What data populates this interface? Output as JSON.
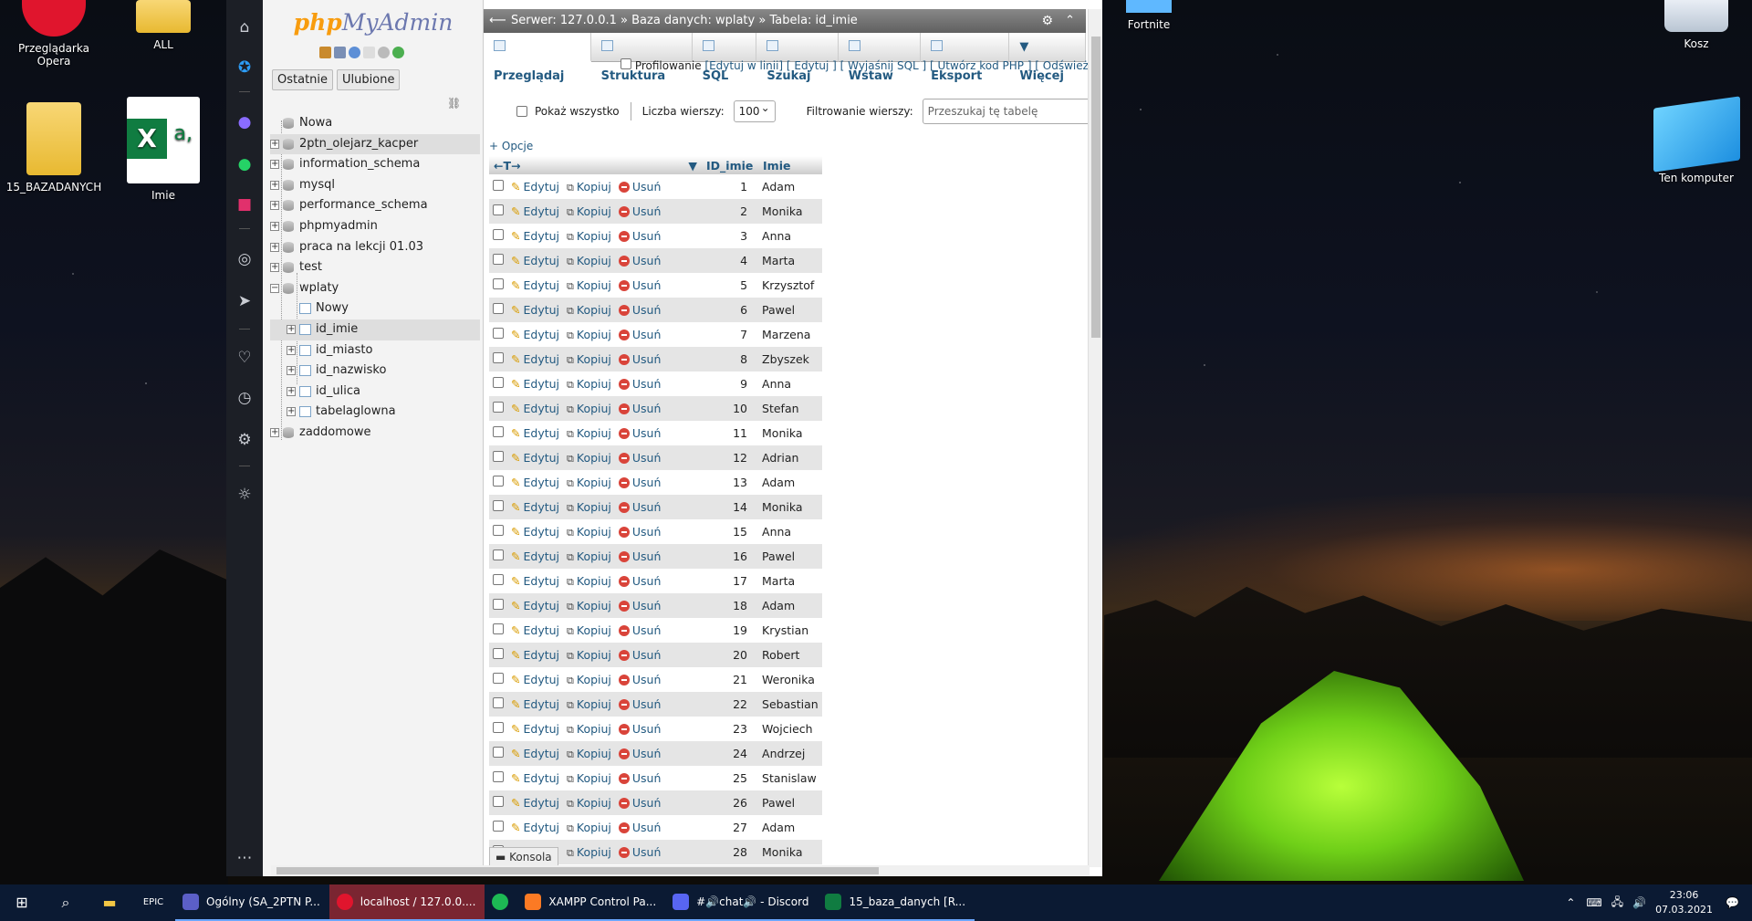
{
  "desktop": {
    "icons": [
      {
        "label": "Przeglądarka Opera"
      },
      {
        "label": "ALL"
      },
      {
        "label": "15_BAZADANYCH"
      },
      {
        "label": "Imie"
      },
      {
        "label": "Fortnite"
      },
      {
        "label": "Kosz"
      },
      {
        "label": "Ten komputer"
      }
    ]
  },
  "sidebar": {
    "logo_php": "php",
    "logo_my": "MyAdmin",
    "tabs": [
      "Ostatnie",
      "Ulubione"
    ],
    "tree": [
      {
        "label": "Nowa"
      },
      {
        "label": "2ptn_olejarz_kacper"
      },
      {
        "label": "information_schema"
      },
      {
        "label": "mysql"
      },
      {
        "label": "performance_schema"
      },
      {
        "label": "phpmyadmin"
      },
      {
        "label": "praca na lekcji 01.03"
      },
      {
        "label": "test"
      },
      {
        "label": "wplaty"
      },
      {
        "label": "Nowy"
      },
      {
        "label": "id_imie"
      },
      {
        "label": "id_miasto"
      },
      {
        "label": "id_nazwisko"
      },
      {
        "label": "id_ulica"
      },
      {
        "label": "tabelaglowna"
      },
      {
        "label": "zaddomowe"
      }
    ]
  },
  "breadcrumb": {
    "server": "Serwer: 127.0.0.1 »",
    "database": "Baza danych: wplaty »",
    "table": "Tabela: id_imie"
  },
  "menu": [
    "Przeglądaj",
    "Struktura",
    "SQL",
    "Szukaj",
    "Wstaw",
    "Eksport",
    "Więcej"
  ],
  "clipped_row": {
    "label": "Profilowanie",
    "links": "[Edytuj w linii] [ Edytuj ] [ Wyjaśnij SQL ] [ Utwórz kod PHP ] [ Odśwież ]"
  },
  "controls": {
    "show_all": "Pokaż wszystko",
    "row_count_label": "Liczba wierszy:",
    "row_count_value": "100",
    "filter_label": "Filtrowanie wierszy:",
    "filter_placeholder": "Przeszukaj tę tabelę"
  },
  "options_link": "+ Opcje",
  "table": {
    "arrows": "←T→",
    "columns": [
      "ID_imie",
      "Imie"
    ],
    "actions": {
      "edit": "Edytuj",
      "copy": "Kopiuj",
      "delete": "Usuń"
    },
    "rows": [
      {
        "id": "1",
        "name": "Adam"
      },
      {
        "id": "2",
        "name": "Monika"
      },
      {
        "id": "3",
        "name": "Anna"
      },
      {
        "id": "4",
        "name": "Marta"
      },
      {
        "id": "5",
        "name": "Krzysztof"
      },
      {
        "id": "6",
        "name": "Pawel"
      },
      {
        "id": "7",
        "name": "Marzena"
      },
      {
        "id": "8",
        "name": "Zbyszek"
      },
      {
        "id": "9",
        "name": "Anna"
      },
      {
        "id": "10",
        "name": "Stefan"
      },
      {
        "id": "11",
        "name": "Monika"
      },
      {
        "id": "12",
        "name": "Adrian"
      },
      {
        "id": "13",
        "name": "Adam"
      },
      {
        "id": "14",
        "name": "Monika"
      },
      {
        "id": "15",
        "name": "Anna"
      },
      {
        "id": "16",
        "name": "Pawel"
      },
      {
        "id": "17",
        "name": "Marta"
      },
      {
        "id": "18",
        "name": "Adam"
      },
      {
        "id": "19",
        "name": "Krystian"
      },
      {
        "id": "20",
        "name": "Robert"
      },
      {
        "id": "21",
        "name": "Weronika"
      },
      {
        "id": "22",
        "name": "Sebastian"
      },
      {
        "id": "23",
        "name": "Wojciech"
      },
      {
        "id": "24",
        "name": "Andrzej"
      },
      {
        "id": "25",
        "name": "Stanislaw"
      },
      {
        "id": "26",
        "name": "Pawel"
      },
      {
        "id": "27",
        "name": "Adam"
      },
      {
        "id": "28",
        "name": "Monika"
      }
    ]
  },
  "console_label": "Konsola",
  "taskbar": {
    "apps": [
      {
        "label": "Ogólny (SA_2PTN P...",
        "color": "#5b5fc7"
      },
      {
        "label": "localhost / 127.0.0....",
        "color": "#e0152d"
      },
      {
        "label": "",
        "color": "#1db954"
      },
      {
        "label": "XAMPP Control Pa...",
        "color": "#fb7a24"
      },
      {
        "label": "#🔊chat🔊 - Discord",
        "color": "#5865f2"
      },
      {
        "label": "15_baza_danych [R...",
        "color": "#107c41"
      }
    ],
    "time": "23:06",
    "date": "07.03.2021"
  }
}
